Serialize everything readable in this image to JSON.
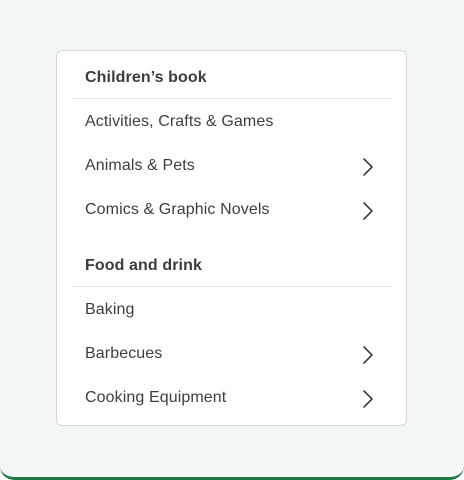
{
  "sections": [
    {
      "header": "Children’s book",
      "items": [
        {
          "label": "Activities, Crafts & Games",
          "has_submenu": false
        },
        {
          "label": "Animals & Pets",
          "has_submenu": true
        },
        {
          "label": "Comics & Graphic Novels",
          "has_submenu": true
        }
      ]
    },
    {
      "header": "Food and drink",
      "items": [
        {
          "label": "Baking",
          "has_submenu": false
        },
        {
          "label": "Barbecues",
          "has_submenu": true
        },
        {
          "label": "Cooking Equipment",
          "has_submenu": true
        }
      ]
    }
  ],
  "colors": {
    "accent_bar": "#1e7a45",
    "background": "#f3f7f5",
    "card": "#ffffff",
    "text": "#3c3e40"
  },
  "icons": {
    "submenu": "chevron-right-icon"
  }
}
